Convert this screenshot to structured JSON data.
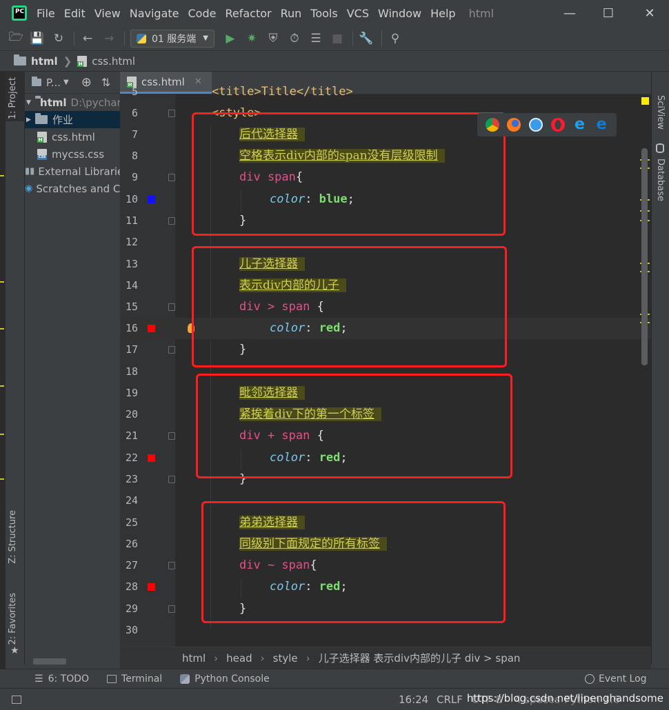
{
  "menu": {
    "items": [
      "File",
      "Edit",
      "View",
      "Navigate",
      "Code",
      "Refactor",
      "Run",
      "Tools",
      "VCS",
      "Window",
      "Help"
    ],
    "window_title": "html"
  },
  "toolbar": {
    "run_config": "01 服务端"
  },
  "navbar": {
    "project": "html",
    "file": "css.html"
  },
  "left_strip": {
    "project_tab": "1: Project",
    "structure_tab": "Z: Structure",
    "favorites_tab": "2: Favorites"
  },
  "project_panel": {
    "header": "P...",
    "root_name": "html",
    "root_path": "D:\\pycharm",
    "folder": "作业",
    "files": [
      "css.html",
      "mycss.css"
    ],
    "external": "External Libraries",
    "scratches": "Scratches and Consoles"
  },
  "editor": {
    "tab_label": "css.html",
    "lines": [
      {
        "n": "5",
        "text": "<title>Title</title>"
      },
      {
        "n": "6",
        "text": "<style>"
      },
      {
        "n": "7",
        "comment": "后代选择器"
      },
      {
        "n": "8",
        "comment": "空格表示div内部的span没有层级限制"
      },
      {
        "n": "9",
        "selector": "div span",
        "brace": "{"
      },
      {
        "n": "10",
        "prop": "color",
        "value": "blue"
      },
      {
        "n": "11",
        "close": "}"
      },
      {
        "n": "12"
      },
      {
        "n": "13",
        "comment": "儿子选择器"
      },
      {
        "n": "14",
        "comment": "表示div内部的儿子"
      },
      {
        "n": "15",
        "selector": "div > span",
        "brace": " {"
      },
      {
        "n": "16",
        "prop": "color",
        "value": "red"
      },
      {
        "n": "17",
        "close": "}"
      },
      {
        "n": "18"
      },
      {
        "n": "19",
        "comment": "毗邻选择器"
      },
      {
        "n": "20",
        "comment": "紧挨着div下的第一个标签"
      },
      {
        "n": "21",
        "selector": "div + span",
        "brace": " {"
      },
      {
        "n": "22",
        "prop": "color",
        "value": "red"
      },
      {
        "n": "23",
        "close": "}"
      },
      {
        "n": "24"
      },
      {
        "n": "25",
        "comment": "弟弟选择器"
      },
      {
        "n": "26",
        "comment": "同级别下面规定的所有标签"
      },
      {
        "n": "27",
        "selector": "div ~ span",
        "brace": "{"
      },
      {
        "n": "28",
        "prop": "color",
        "value": "red"
      },
      {
        "n": "29",
        "close": "}"
      },
      {
        "n": "30"
      }
    ]
  },
  "right_strip": {
    "sciview": "SciView",
    "database": "Database"
  },
  "editor_breadcrumb": [
    "html",
    "head",
    "style",
    "儿子选择器 表示div内部的儿子 div > span"
  ],
  "bottom_tabs": {
    "todo": "6: TODO",
    "terminal": "Terminal",
    "python_console": "Python Console",
    "event_log": "Event Log"
  },
  "status": {
    "position": "16:24",
    "line_sep": "CRLF",
    "encoding": "UTF-8",
    "spaces": "4 spaces",
    "interpreter": "Python 3.6"
  },
  "watermark": "https://blog.csdn.net/lipenghandsome",
  "colors": {
    "marker_blue": "#1111ff",
    "marker_red": "#ff0000",
    "highlight_box": "#ff1e1e"
  }
}
